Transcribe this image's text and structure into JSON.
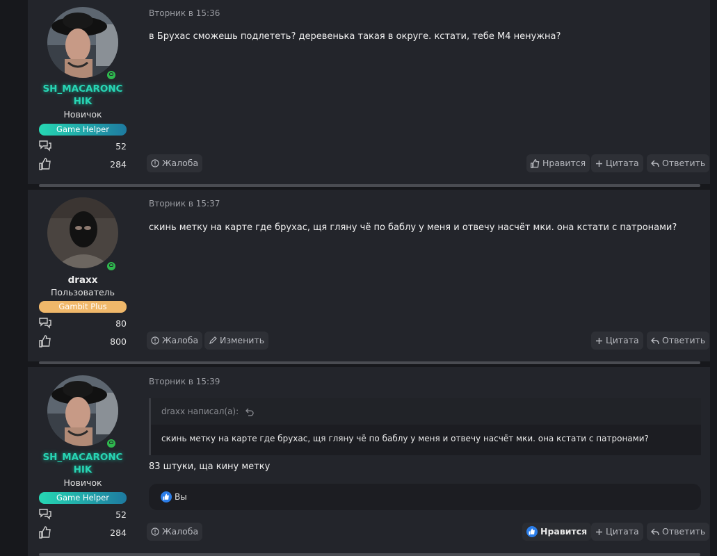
{
  "posts": [
    {
      "time": "Вторник в 15:36",
      "username": "SH_MACARONCHIK",
      "user_title": "Новичок",
      "badge": "Game Helper",
      "messages_count": "52",
      "likes_count": "284",
      "text": "в Брухас сможешь подлететь? деревенька такая в округе. кстати, тебе М4 ненужна?",
      "actions": {
        "report": "Жалоба",
        "like": "Нравится",
        "quote": "Цитата",
        "reply": "Ответить"
      }
    },
    {
      "time": "Вторник в 15:37",
      "username": "draxx",
      "user_title": "Пользователь",
      "badge": "Gambit Plus",
      "messages_count": "80",
      "likes_count": "800",
      "text": "скинь метку на карте где брухас, щя гляну чё по баблу у меня и отвечу насчёт мки. она кстати с патронами?",
      "actions": {
        "report": "Жалоба",
        "edit": "Изменить",
        "quote": "Цитата",
        "reply": "Ответить"
      }
    },
    {
      "time": "Вторник в 15:39",
      "username": "SH_MACARONCHIK",
      "user_title": "Новичок",
      "badge": "Game Helper",
      "messages_count": "52",
      "likes_count": "284",
      "quote": {
        "author_line": "draxx написал(а):",
        "text": "скинь метку на карте где брухас, щя гляну чё по баблу у меня и отвечу насчёт мки. она кстати с патронами?"
      },
      "text": "83 штуки, ща кину метку",
      "reactions_text": "Вы",
      "actions": {
        "report": "Жалоба",
        "like": "Нравится",
        "quote": "Цитата",
        "reply": "Ответить"
      }
    }
  ],
  "colors": {
    "helper_name": "#28d5b4",
    "online": "#2fb84e",
    "gambit_badge": "#f0b86a",
    "like_blue": "#2b7de8"
  },
  "icons": [
    "online-icon",
    "messages-icon",
    "thumbs-up-icon",
    "info-icon",
    "pencil-icon",
    "plus-icon",
    "reply-icon",
    "undo-arrow-icon"
  ]
}
